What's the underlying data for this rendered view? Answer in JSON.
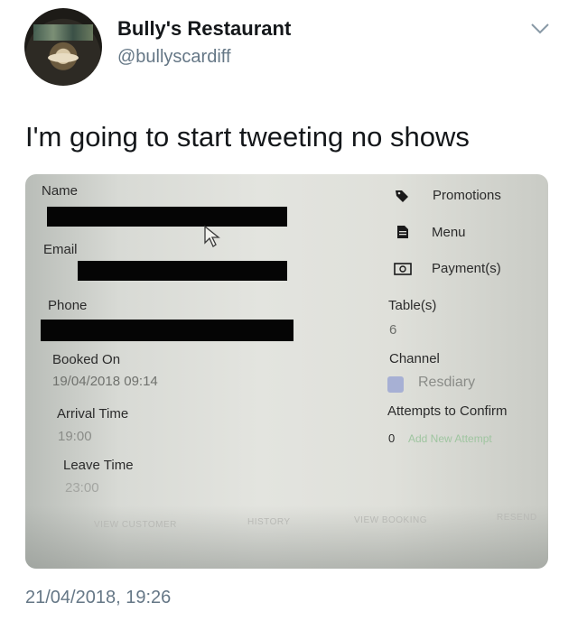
{
  "tweet": {
    "display_name": "Bully's Restaurant",
    "handle": "@bullyscardiff",
    "text": "I'm going to start tweeting no shows",
    "timestamp": "21/04/2018, 19:26"
  },
  "booking": {
    "name_label": "Name",
    "email_label": "Email",
    "phone_label": "Phone",
    "booked_on_label": "Booked On",
    "booked_on_value": "19/04/2018 09:14",
    "arrival_label": "Arrival Time",
    "arrival_value": "19:00",
    "leave_label": "Leave Time",
    "leave_value": "23:00",
    "promotions_label": "Promotions",
    "menu_label": "Menu",
    "payments_label": "Payment(s)",
    "tables_label": "Table(s)",
    "tables_value": "6",
    "channel_label": "Channel",
    "channel_value": "Resdiary",
    "attempts_label": "Attempts to Confirm",
    "attempts_count": "0",
    "attempts_link": "Add New Attempt",
    "nav": {
      "view_customer": "VIEW CUSTOMER",
      "history": "HISTORY",
      "view_booking": "VIEW BOOKING",
      "resend": "RESEND"
    }
  },
  "colors": {
    "text_primary": "#14171a",
    "text_secondary": "#657786",
    "redaction": "#050505",
    "channel_swatch": "#a7b0d4"
  }
}
